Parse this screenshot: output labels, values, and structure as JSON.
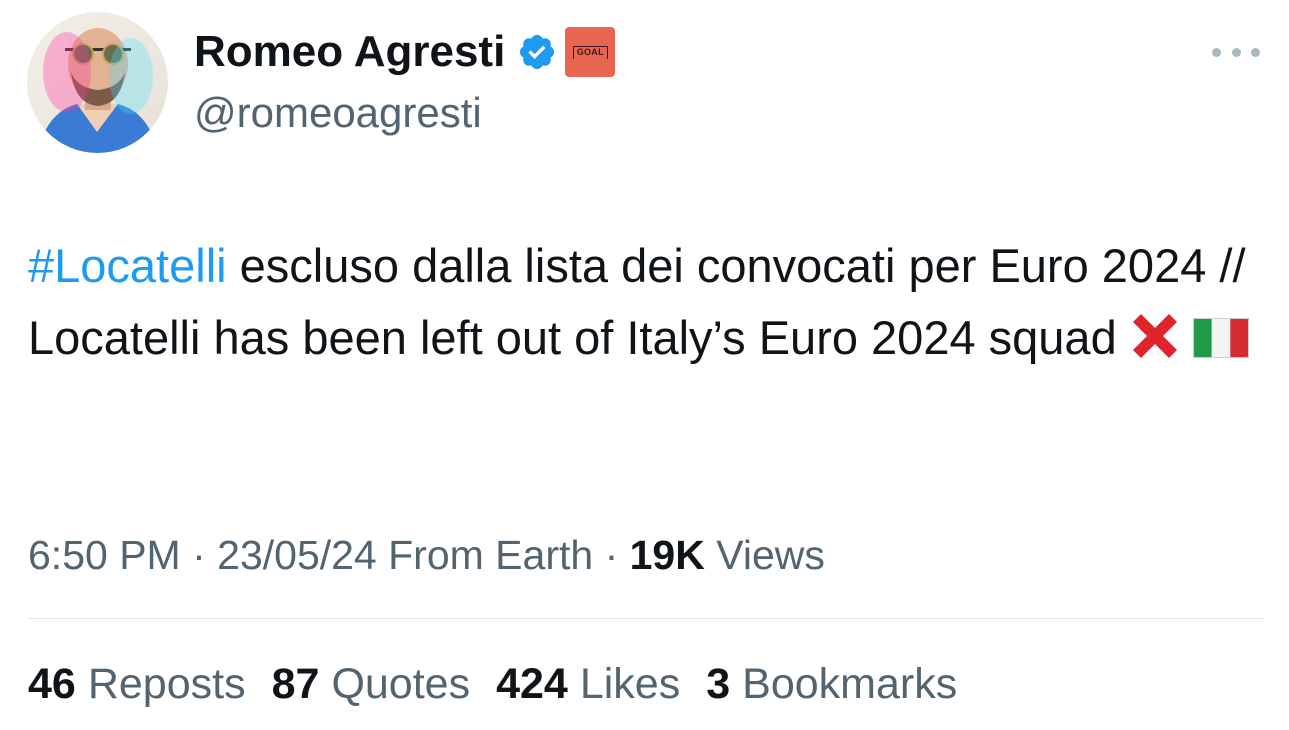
{
  "author": {
    "display_name": "Romeo Agresti",
    "handle": "@romeoagresti",
    "verified_icon": "verified-badge-icon",
    "affiliate_badge_text": "GOAL"
  },
  "tweet": {
    "hashtag": "#Locatelli",
    "text": " escluso dalla lista dei convocati per Euro 2024 // Locatelli has been left out of Italy’s Euro 2024 squad",
    "emojis": [
      "cross-mark-emoji",
      "italy-flag-emoji"
    ]
  },
  "meta": {
    "time": "6:50 PM",
    "sep1": " · ",
    "date": "23/05/24",
    "source": " From Earth",
    "sep2": " · ",
    "views_count": "19K",
    "views_label": " Views"
  },
  "stats": [
    {
      "count": "46",
      "label": "Reposts"
    },
    {
      "count": "87",
      "label": "Quotes"
    },
    {
      "count": "424",
      "label": "Likes"
    },
    {
      "count": "3",
      "label": "Bookmarks"
    }
  ],
  "colors": {
    "link": "#1d9bf0",
    "secondary_text": "#536471",
    "primary_text": "#0f1419",
    "goal_badge": "#e8654f"
  }
}
